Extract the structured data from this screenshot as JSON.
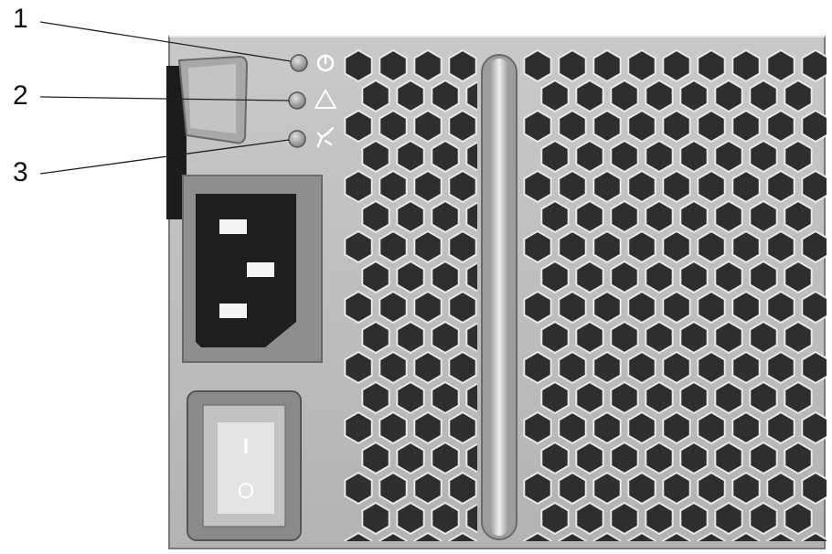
{
  "callouts": [
    {
      "number": "1",
      "indicator": "power-led"
    },
    {
      "number": "2",
      "indicator": "fault-led"
    },
    {
      "number": "3",
      "indicator": "ac-status-led"
    }
  ],
  "icons": {
    "led1": "power-icon",
    "led2": "warning-triangle-icon",
    "led3": "plug-icon"
  },
  "switch": {
    "on_symbol": "I",
    "off_symbol": "O"
  },
  "colors": {
    "panel": "#bdbdbd",
    "panel_edge": "#8c8c8c",
    "vent_hole": "#2f2f2f",
    "led": "#9a9a9a",
    "connector": "#1e1e1e",
    "switch_face": "#d8d8d8",
    "switch_bezel": "#6e6e6e"
  }
}
